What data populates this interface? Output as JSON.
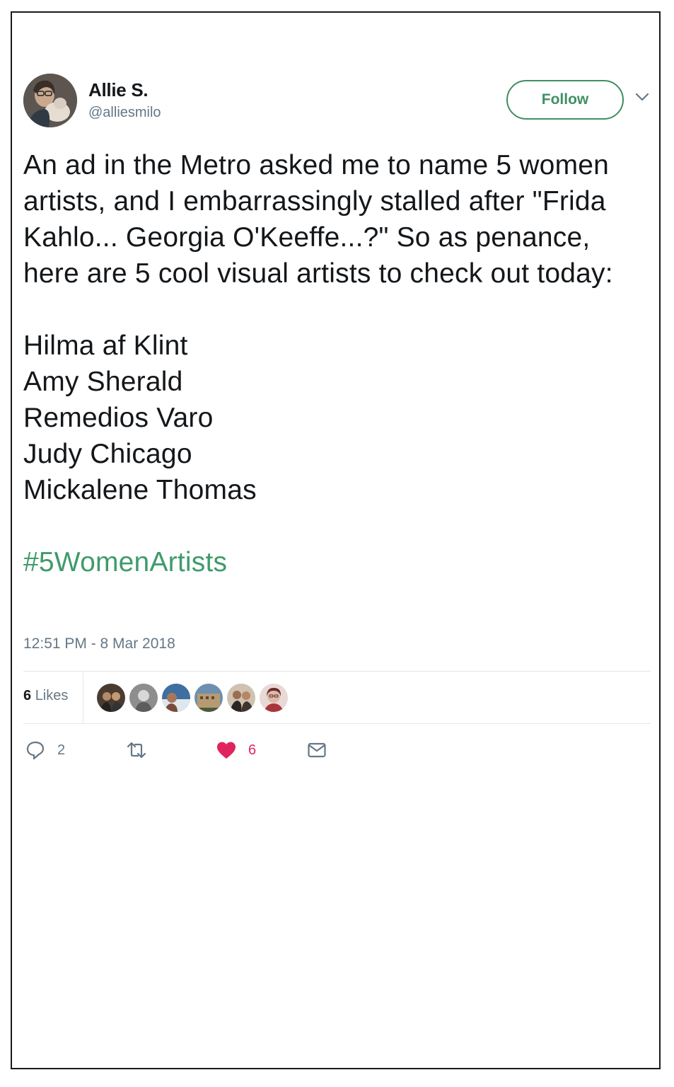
{
  "user": {
    "display_name": "Allie S.",
    "handle": "@alliesmilo",
    "follow_label": "Follow"
  },
  "tweet": {
    "intro": "An ad in the Metro asked me to name 5 women artists, and I embarrassingly stalled after \"Frida Kahlo... Georgia O'Keeffe...?\" So as penance, here are 5 cool visual artists to check out today:",
    "artists": [
      "Hilma af Klint",
      "Amy Sherald",
      "Remedios Varo",
      "Judy Chicago",
      "Mickalene Thomas"
    ],
    "hashtag": "#5WomenArtists",
    "timestamp": "12:51 PM - 8 Mar 2018"
  },
  "stats": {
    "likes_number": "6",
    "likes_label": "Likes",
    "liker_avatars": [
      "avatar-1",
      "avatar-2",
      "avatar-3",
      "avatar-4",
      "avatar-5",
      "avatar-6"
    ]
  },
  "actions": {
    "reply_count": "2",
    "retweet_count": "",
    "like_count": "6"
  },
  "colors": {
    "accent_green": "#3f8f63",
    "hashtag_green": "#3f9b6a",
    "like_red": "#e0245e",
    "muted_gray": "#657786"
  },
  "icons": {
    "reply": "reply-icon",
    "retweet": "retweet-icon",
    "like": "heart-icon",
    "dm": "envelope-icon",
    "more": "chevron-down-icon"
  }
}
